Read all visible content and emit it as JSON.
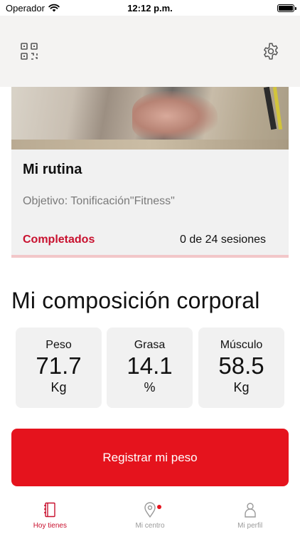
{
  "status_bar": {
    "carrier": "Operador",
    "time": "12:12 p.m.",
    "wifi_icon": "wifi-icon",
    "battery_icon": "battery-icon"
  },
  "top_nav": {
    "left_icon": "qr-code-icon",
    "right_icon": "gear-icon"
  },
  "routine": {
    "title": "Mi rutina",
    "goal": "Objetivo: Tonificación\"Fitness\"",
    "completed_label": "Completados",
    "sessions_text": "0 de 24 sesiones",
    "completed_sessions": 0,
    "total_sessions": 24
  },
  "composition": {
    "title": "Mi composición corporal",
    "metrics": [
      {
        "label": "Peso",
        "value": "71.7",
        "unit": "Kg"
      },
      {
        "label": "Grasa",
        "value": "14.1",
        "unit": "%"
      },
      {
        "label": "Músculo",
        "value": "58.5",
        "unit": "Kg"
      }
    ]
  },
  "actions": {
    "register_weight": "Registrar mi peso"
  },
  "tab_bar": {
    "tabs": [
      {
        "label": "Hoy tienes",
        "icon": "notebook-icon",
        "active": true
      },
      {
        "label": "Mi centro",
        "icon": "location-pin-icon",
        "active": false,
        "badge": true
      },
      {
        "label": "Mi perfil",
        "icon": "person-icon",
        "active": false
      }
    ]
  },
  "colors": {
    "accent_red": "#e5131d",
    "label_red": "#c8102e",
    "card_bg": "#f1f1f1",
    "nav_bg": "#f4f3f2",
    "progress_track": "#f2c7c9"
  }
}
